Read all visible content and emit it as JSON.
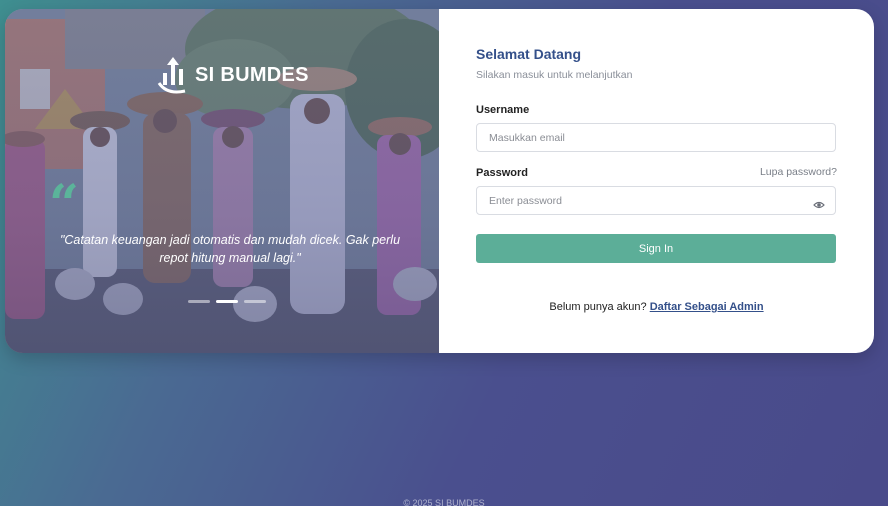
{
  "brand": {
    "name": "SI BUMDES",
    "logo_icon": "bar-chart-arrow-icon"
  },
  "hero": {
    "quote_icon": "quote-icon",
    "quote": "\"Catatan keuangan jadi otomatis dan mudah dicek. Gak perlu repot hitung manual lagi.\"",
    "slides": [
      {
        "active": false
      },
      {
        "active": true
      },
      {
        "active": false
      }
    ]
  },
  "form": {
    "title": "Selamat Datang",
    "subtitle": "Silakan masuk untuk melanjutkan",
    "username_label": "Username",
    "username_placeholder": "Masukkan email",
    "username_value": "",
    "password_label": "Password",
    "password_placeholder": "Enter password",
    "password_value": "",
    "forgot_label": "Lupa password?",
    "password_toggle_icon": "eye-icon",
    "submit_label": "Sign In",
    "register_prompt": "Belum punya akun?",
    "register_link": "Daftar Sebagai Admin"
  },
  "colors": {
    "accent_green": "#5cae98",
    "title_blue": "#34508a",
    "background": "#494a8a"
  },
  "footer": {
    "text": "© 2025 SI BUMDES"
  }
}
